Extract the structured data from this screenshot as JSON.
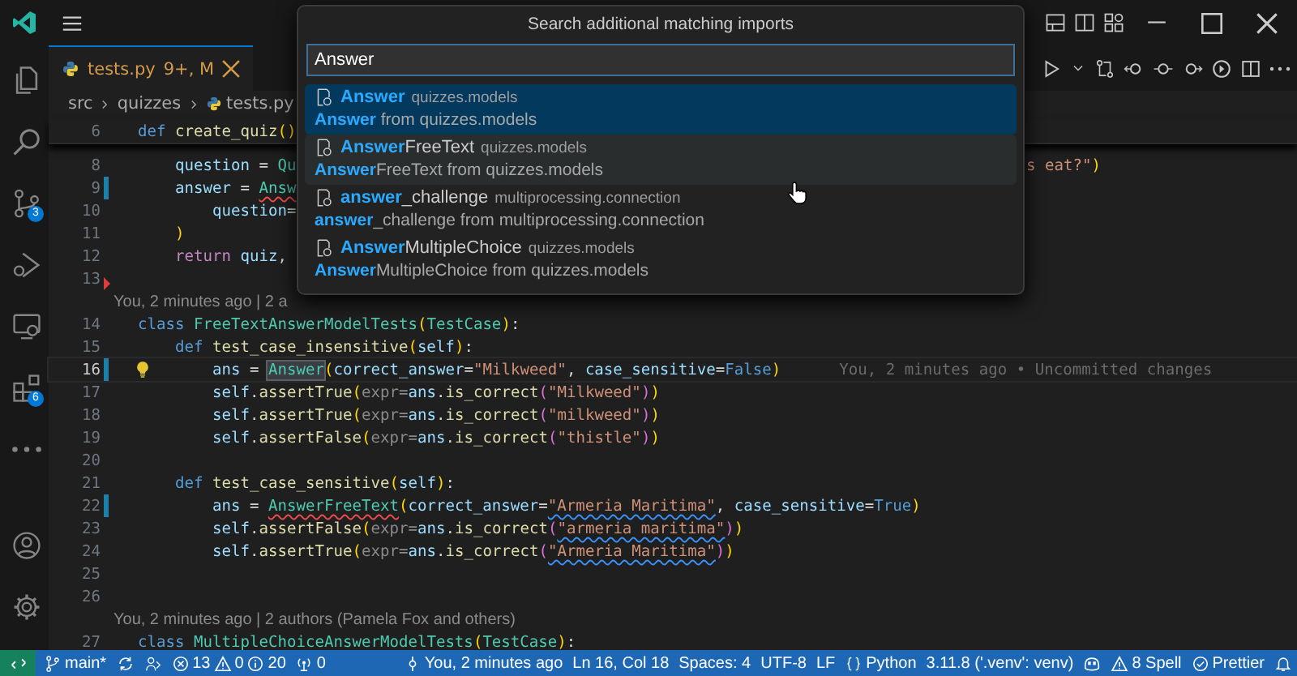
{
  "activity_bar": {
    "items": [
      {
        "selected": false
      },
      {
        "selected": false
      },
      {
        "selected": false,
        "badge": "3"
      },
      {
        "selected": false
      },
      {
        "selected": false
      },
      {
        "selected": false,
        "badge": "6"
      },
      {
        "selected": false
      }
    ],
    "bottom_items": [
      {
        "selected": false
      },
      {
        "selected": false
      }
    ]
  },
  "tabs": [
    {
      "label": "tests.py",
      "decoration": "9+, M",
      "selected": true
    }
  ],
  "breadcrumbs": [
    "src",
    "quizzes",
    "tests.py"
  ],
  "popup": {
    "title": "Search additional matching imports",
    "input": {
      "value": "Answer"
    },
    "items": [
      {
        "label": "**Answer**",
        "description": "quizzes.models",
        "detail": "**Answer** from quizzes.models",
        "selected": true,
        "hovered": false
      },
      {
        "label": "**Answer**FreeText",
        "description": "quizzes.models",
        "detail": "**Answer**FreeText from quizzes.models",
        "selected": false,
        "hovered": true
      },
      {
        "label": "**answer**_challenge",
        "description": "multiprocessing.connection",
        "detail": "**answer**_challenge from multiprocessing.connection",
        "selected": false,
        "hovered": false
      },
      {
        "label": "**Answer**MultipleChoice",
        "description": "quizzes.models",
        "detail": "**Answer**MultipleChoice from quizzes.models",
        "selected": false,
        "hovered": false
      }
    ]
  },
  "editor": {
    "lines": [
      {
        "kind": "code",
        "num": "6",
        "current": false,
        "sticky": true,
        "tokens": [
          {
            "t": "def ",
            "kind": "kw"
          },
          {
            "t": "create_quiz",
            "kind": "fn"
          },
          {
            "t": "()",
            "kind": "br"
          }
        ]
      },
      {
        "kind": "code",
        "num": "8",
        "current": false,
        "tokens": [
          {
            "t": "    question",
            "kind": "var"
          },
          {
            "t": " = ",
            "kind": "plain"
          },
          {
            "t": "Qu",
            "kind": "cls"
          }
        ],
        "tail": [
          {
            "t": "s eat?\"",
            "kind": "str"
          },
          {
            "t": ")",
            "kind": "br"
          }
        ]
      },
      {
        "kind": "code",
        "num": "9",
        "current": false,
        "gutter": {
          "kind": "modified"
        },
        "tokens": [
          {
            "t": "    answer",
            "kind": "var"
          },
          {
            "t": " = ",
            "kind": "plain"
          },
          {
            "t": "Answ",
            "kind": "cls",
            "deco": {
              "kind": "error"
            }
          }
        ]
      },
      {
        "kind": "code",
        "num": "10",
        "current": false,
        "tokens": [
          {
            "t": "        question",
            "kind": "var"
          },
          {
            "t": "=",
            "kind": "plain"
          }
        ]
      },
      {
        "kind": "code",
        "num": "11",
        "current": false,
        "tokens": [
          {
            "t": "    )",
            "kind": "br"
          }
        ]
      },
      {
        "kind": "code",
        "num": "12",
        "current": false,
        "tokens": [
          {
            "t": "    return ",
            "kind": "ctl"
          },
          {
            "t": "quiz",
            "kind": "var"
          },
          {
            "t": ",",
            "kind": "plain"
          }
        ]
      },
      {
        "kind": "code",
        "num": "13",
        "current": false,
        "gutter": {
          "kind": "deleted"
        }
      },
      {
        "kind": "blame",
        "text": "You, 2 minutes ago | 2 a"
      },
      {
        "kind": "code",
        "num": "14",
        "current": false,
        "tokens": [
          {
            "t": "class ",
            "kind": "kw"
          },
          {
            "t": "FreeTextAnswerModelTests",
            "kind": "cls"
          },
          {
            "t": "(",
            "kind": "br"
          },
          {
            "t": "TestCase",
            "kind": "cls"
          },
          {
            "t": ")",
            "kind": "br"
          },
          {
            "t": ":",
            "kind": "plain"
          }
        ]
      },
      {
        "kind": "code",
        "num": "15",
        "current": false,
        "tokens": [
          {
            "t": "    def ",
            "kind": "kw"
          },
          {
            "t": "test_case_insensitive",
            "kind": "fn"
          },
          {
            "t": "(",
            "kind": "br"
          },
          {
            "t": "self",
            "kind": "var"
          },
          {
            "t": ")",
            "kind": "br"
          },
          {
            "t": ":",
            "kind": "plain"
          }
        ]
      },
      {
        "kind": "code",
        "num": "16",
        "current": true,
        "gutter": {
          "kind": "modified"
        },
        "lightbulb": true,
        "tokens": [
          {
            "t": "        ans",
            "kind": "var"
          },
          {
            "t": " = ",
            "kind": "plain"
          },
          {
            "t": "Answer",
            "kind": "cls",
            "deco": {
              "kind": "highlight"
            }
          },
          {
            "t": "(",
            "kind": "br"
          },
          {
            "t": "correct_answer",
            "kind": "var"
          },
          {
            "t": "=",
            "kind": "plain"
          },
          {
            "t": "\"Milkweed\"",
            "kind": "str"
          },
          {
            "t": ", ",
            "kind": "plain"
          },
          {
            "t": "case_sensitive",
            "kind": "var"
          },
          {
            "t": "=",
            "kind": "plain"
          },
          {
            "t": "False",
            "kind": "kw"
          },
          {
            "t": ")",
            "kind": "br"
          }
        ],
        "blame": "You, 2 minutes ago • Uncommitted changes"
      },
      {
        "kind": "code",
        "num": "17",
        "current": false,
        "tokens": [
          {
            "t": "        self",
            "kind": "var"
          },
          {
            "t": ".",
            "kind": "plain"
          },
          {
            "t": "assertTrue",
            "kind": "fn"
          },
          {
            "t": "(",
            "kind": "br"
          },
          {
            "t": "expr=",
            "kind": "hint"
          },
          {
            "t": "ans",
            "kind": "var"
          },
          {
            "t": ".",
            "kind": "plain"
          },
          {
            "t": "is_correct",
            "kind": "fn"
          },
          {
            "t": "(",
            "kind": "br2"
          },
          {
            "t": "\"Milkweed\"",
            "kind": "str"
          },
          {
            "t": ")",
            "kind": "br2"
          },
          {
            "t": ")",
            "kind": "br"
          }
        ]
      },
      {
        "kind": "code",
        "num": "18",
        "current": false,
        "tokens": [
          {
            "t": "        self",
            "kind": "var"
          },
          {
            "t": ".",
            "kind": "plain"
          },
          {
            "t": "assertTrue",
            "kind": "fn"
          },
          {
            "t": "(",
            "kind": "br"
          },
          {
            "t": "expr=",
            "kind": "hint"
          },
          {
            "t": "ans",
            "kind": "var"
          },
          {
            "t": ".",
            "kind": "plain"
          },
          {
            "t": "is_correct",
            "kind": "fn"
          },
          {
            "t": "(",
            "kind": "br2"
          },
          {
            "t": "\"milkweed\"",
            "kind": "str"
          },
          {
            "t": ")",
            "kind": "br2"
          },
          {
            "t": ")",
            "kind": "br"
          }
        ]
      },
      {
        "kind": "code",
        "num": "19",
        "current": false,
        "tokens": [
          {
            "t": "        self",
            "kind": "var"
          },
          {
            "t": ".",
            "kind": "plain"
          },
          {
            "t": "assertFalse",
            "kind": "fn"
          },
          {
            "t": "(",
            "kind": "br"
          },
          {
            "t": "expr=",
            "kind": "hint"
          },
          {
            "t": "ans",
            "kind": "var"
          },
          {
            "t": ".",
            "kind": "plain"
          },
          {
            "t": "is_correct",
            "kind": "fn"
          },
          {
            "t": "(",
            "kind": "br2"
          },
          {
            "t": "\"thistle\"",
            "kind": "str"
          },
          {
            "t": ")",
            "kind": "br2"
          },
          {
            "t": ")",
            "kind": "br"
          }
        ]
      },
      {
        "kind": "code",
        "num": "20",
        "current": false
      },
      {
        "kind": "code",
        "num": "21",
        "current": false,
        "tokens": [
          {
            "t": "    def ",
            "kind": "kw"
          },
          {
            "t": "test_case_sensitive",
            "kind": "fn"
          },
          {
            "t": "(",
            "kind": "br"
          },
          {
            "t": "self",
            "kind": "var"
          },
          {
            "t": ")",
            "kind": "br"
          },
          {
            "t": ":",
            "kind": "plain"
          }
        ]
      },
      {
        "kind": "code",
        "num": "22",
        "current": false,
        "gutter": {
          "kind": "modified"
        },
        "tokens": [
          {
            "t": "        ans",
            "kind": "var"
          },
          {
            "t": " = ",
            "kind": "plain"
          },
          {
            "t": "AnswerFreeText",
            "kind": "cls",
            "deco": {
              "kind": "error"
            }
          },
          {
            "t": "(",
            "kind": "br"
          },
          {
            "t": "correct_answer",
            "kind": "var"
          },
          {
            "t": "=",
            "kind": "plain"
          },
          {
            "t": "\"Armeria Maritima\"",
            "kind": "str",
            "deco": {
              "kind": "spell"
            }
          },
          {
            "t": ", ",
            "kind": "plain"
          },
          {
            "t": "case_sensitive",
            "kind": "var"
          },
          {
            "t": "=",
            "kind": "plain"
          },
          {
            "t": "True",
            "kind": "kw"
          },
          {
            "t": ")",
            "kind": "br"
          }
        ]
      },
      {
        "kind": "code",
        "num": "23",
        "current": false,
        "tokens": [
          {
            "t": "        self",
            "kind": "var"
          },
          {
            "t": ".",
            "kind": "plain"
          },
          {
            "t": "assertFalse",
            "kind": "fn"
          },
          {
            "t": "(",
            "kind": "br"
          },
          {
            "t": "expr=",
            "kind": "hint"
          },
          {
            "t": "ans",
            "kind": "var"
          },
          {
            "t": ".",
            "kind": "plain"
          },
          {
            "t": "is_correct",
            "kind": "fn"
          },
          {
            "t": "(",
            "kind": "br2"
          },
          {
            "t": "\"armeria maritima\"",
            "kind": "str",
            "deco": {
              "kind": "spell"
            }
          },
          {
            "t": ")",
            "kind": "br2"
          },
          {
            "t": ")",
            "kind": "br"
          }
        ]
      },
      {
        "kind": "code",
        "num": "24",
        "current": false,
        "tokens": [
          {
            "t": "        self",
            "kind": "var"
          },
          {
            "t": ".",
            "kind": "plain"
          },
          {
            "t": "assertTrue",
            "kind": "fn"
          },
          {
            "t": "(",
            "kind": "br"
          },
          {
            "t": "expr=",
            "kind": "hint"
          },
          {
            "t": "ans",
            "kind": "var"
          },
          {
            "t": ".",
            "kind": "plain"
          },
          {
            "t": "is_correct",
            "kind": "fn"
          },
          {
            "t": "(",
            "kind": "br2"
          },
          {
            "t": "\"Armeria Maritima\"",
            "kind": "str",
            "deco": {
              "kind": "spell"
            }
          },
          {
            "t": ")",
            "kind": "br2"
          },
          {
            "t": ")",
            "kind": "br"
          }
        ]
      },
      {
        "kind": "code",
        "num": "25",
        "current": false
      },
      {
        "kind": "code",
        "num": "26",
        "current": false
      },
      {
        "kind": "blame",
        "text": "You, 2 minutes ago | 2 authors (Pamela Fox and others)"
      },
      {
        "kind": "code",
        "num": "27",
        "current": false,
        "tokens": [
          {
            "t": "class ",
            "kind": "kw"
          },
          {
            "t": "MultipleChoiceAnswerModelTests",
            "kind": "cls"
          },
          {
            "t": "(",
            "kind": "br"
          },
          {
            "t": "TestCase",
            "kind": "cls"
          },
          {
            "t": ")",
            "kind": "br"
          },
          {
            "t": ":",
            "kind": "plain"
          }
        ]
      }
    ]
  },
  "status_bar": {
    "left": [
      {
        "kind": "remote"
      },
      {
        "kind": "branch",
        "text": "main*"
      },
      {
        "kind": "sync"
      },
      {
        "kind": "tool"
      },
      {
        "kind": "problems",
        "errors": "13",
        "warnings": "0",
        "infos": "20"
      },
      {
        "kind": "ports",
        "text": "0"
      }
    ],
    "right": [
      {
        "kind": "blame",
        "text": "You, 2 minutes ago"
      },
      {
        "kind": "text",
        "text": "Ln 16, Col 18"
      },
      {
        "kind": "text",
        "text": "Spaces: 4"
      },
      {
        "kind": "text",
        "text": "UTF-8"
      },
      {
        "kind": "text",
        "text": "LF"
      },
      {
        "kind": "language",
        "text": "Python"
      },
      {
        "kind": "text",
        "text": "3.11.8 ('.venv': venv)"
      },
      {
        "kind": "copilot"
      },
      {
        "kind": "warning",
        "text": "8 Spell"
      },
      {
        "kind": "check",
        "text": "Prettier"
      },
      {
        "kind": "bell"
      }
    ]
  }
}
